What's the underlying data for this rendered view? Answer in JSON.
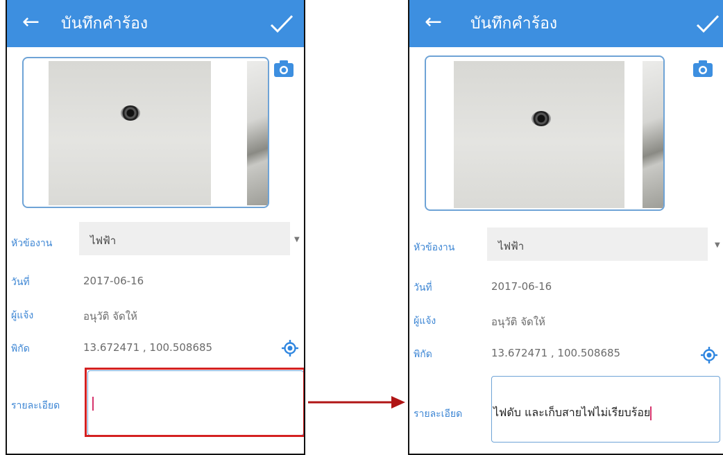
{
  "colors": {
    "appbar": "#3d8fe0",
    "label": "#3d86d4",
    "highlight": "#d42121",
    "arrow": "#b01515"
  },
  "left": {
    "title": "บันทึกคำร้อง",
    "back_icon": "←",
    "topic_label": "หัวข้องาน",
    "topic_value": "ไฟฟ้า",
    "date_label": "วันที่",
    "date_value": "2017-06-16",
    "reporter_label": "ผู้แจ้ง",
    "reporter_value": "อนุวัติ จัดให้",
    "coord_label": "พิกัด",
    "coord_value": "13.672471 , 100.508685",
    "detail_label": "รายละเอียด",
    "detail_value": ""
  },
  "right": {
    "title": "บันทึกคำร้อง",
    "back_icon": "←",
    "topic_label": "หัวข้องาน",
    "topic_value": "ไฟฟ้า",
    "date_label": "วันที่",
    "date_value": "2017-06-16",
    "reporter_label": "ผู้แจ้ง",
    "reporter_value": "อนุวัติ จัดให้",
    "coord_label": "พิกัด",
    "coord_value": "13.672471 , 100.508685",
    "detail_label": "รายละเอียด",
    "detail_value": "ไฟดับ และเก็บสายไฟไม่เรียบร้อย"
  }
}
